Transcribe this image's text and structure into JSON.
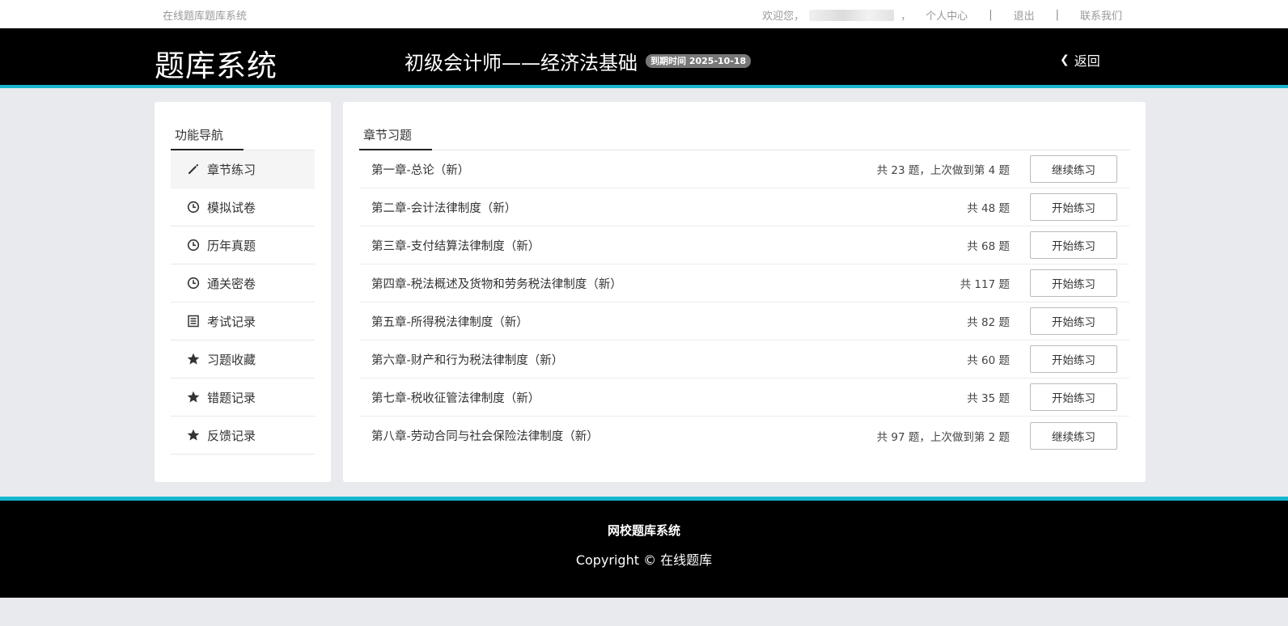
{
  "topbar": {
    "site_name": "在线题库题库系统",
    "welcome": "欢迎您，",
    "comma": "，",
    "links": [
      "个人中心",
      "退出",
      "联系我们"
    ],
    "separator": "|"
  },
  "header": {
    "logo": "题库系统",
    "course_title": "初级会计师——经济法基础",
    "expiry_badge": "到期时间 2025-10-18",
    "back_label": "返回"
  },
  "sidebar": {
    "title": "功能导航",
    "items": [
      {
        "label": "章节练习",
        "icon": "pencil-icon"
      },
      {
        "label": "模拟试卷",
        "icon": "clock-icon"
      },
      {
        "label": "历年真题",
        "icon": "clock-icon"
      },
      {
        "label": "通关密卷",
        "icon": "clock-icon"
      },
      {
        "label": "考试记录",
        "icon": "list-icon"
      },
      {
        "label": "习题收藏",
        "icon": "star-icon"
      },
      {
        "label": "错题记录",
        "icon": "star-icon"
      },
      {
        "label": "反馈记录",
        "icon": "star-icon"
      }
    ]
  },
  "content": {
    "tab": "章节习题",
    "chapters": [
      {
        "name": "第一章-总论（新）",
        "count": "共 23 题，上次做到第 4 题",
        "action": "继续练习"
      },
      {
        "name": "第二章-会计法律制度（新）",
        "count": "共 48 题",
        "action": "开始练习"
      },
      {
        "name": "第三章-支付结算法律制度（新）",
        "count": "共 68 题",
        "action": "开始练习"
      },
      {
        "name": "第四章-税法概述及货物和劳务税法律制度（新）",
        "count": "共 117 题",
        "action": "开始练习"
      },
      {
        "name": "第五章-所得税法律制度（新）",
        "count": "共 82 题",
        "action": "开始练习"
      },
      {
        "name": "第六章-财产和行为税法律制度（新）",
        "count": "共 60 题",
        "action": "开始练习"
      },
      {
        "name": "第七章-税收征管法律制度（新）",
        "count": "共 35 题",
        "action": "开始练习"
      },
      {
        "name": "第八章-劳动合同与社会保险法律制度（新）",
        "count": "共 97 题，上次做到第 2 题",
        "action": "继续练习"
      }
    ]
  },
  "footer": {
    "line1": "网校题库系统",
    "line2": "Copyright © 在线题库"
  },
  "colors": {
    "accent": "#17b6cf",
    "header_bg": "#000000",
    "page_bg": "#e8eaed"
  }
}
